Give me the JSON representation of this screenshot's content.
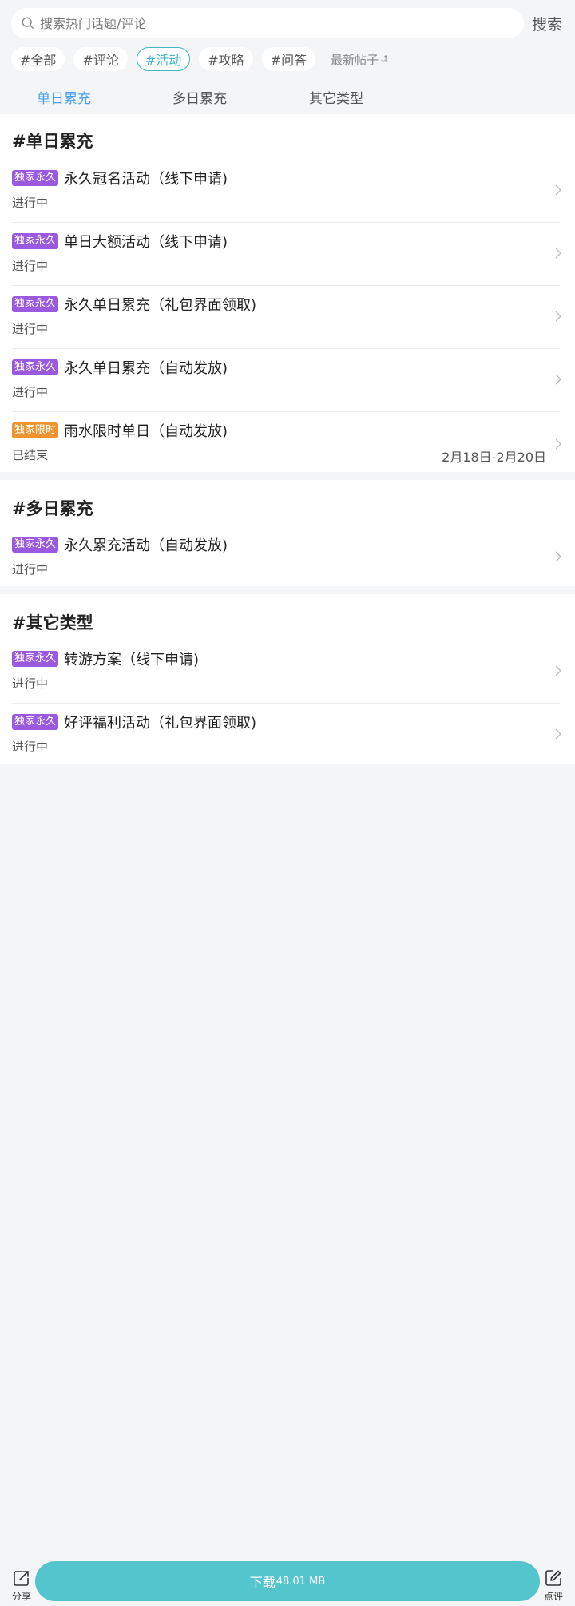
{
  "search": {
    "placeholder": "搜索热门话题/评论",
    "button_label": "搜索"
  },
  "tags": [
    {
      "label": "#全部"
    },
    {
      "label": "#评论"
    },
    {
      "label": "#活动"
    },
    {
      "label": "#攻略"
    },
    {
      "label": "#问答"
    }
  ],
  "sort": {
    "label": "最新帖子",
    "icon": "sort-arrows-icon"
  },
  "subtabs": [
    "单日累充",
    "多日累充",
    "其它类型"
  ],
  "sections": [
    {
      "title": "#单日累充",
      "items": [
        {
          "badge": "独家永久",
          "title": "永久冠名活动（线下申请)",
          "status": "进行中",
          "date": ""
        },
        {
          "badge": "独家永久",
          "title": "单日大额活动（线下申请)",
          "status": "进行中",
          "date": ""
        },
        {
          "badge": "独家永久",
          "title": "永久单日累充（礼包界面领取)",
          "status": "进行中",
          "date": ""
        },
        {
          "badge": "独家永久",
          "title": "永久单日累充（自动发放)",
          "status": "进行中",
          "date": ""
        },
        {
          "badge": "独家限时",
          "title": "雨水限时单日（自动发放)",
          "status": "已结束",
          "date": "2月18日-2月20日"
        }
      ]
    },
    {
      "title": "#多日累充",
      "items": [
        {
          "badge": "独家永久",
          "title": "永久累充活动（自动发放)",
          "status": "进行中",
          "date": ""
        }
      ]
    },
    {
      "title": "#其它类型",
      "items": [
        {
          "badge": "独家永久",
          "title": "转游方案（线下申请)",
          "status": "进行中",
          "date": ""
        },
        {
          "badge": "独家永久",
          "title": "好评福利活动（礼包界面领取)",
          "status": "进行中",
          "date": ""
        }
      ]
    }
  ],
  "bottom": {
    "share_label": "分享",
    "download_label": "下载",
    "download_size": "48.01 MB",
    "review_label": "点评"
  },
  "colors": {
    "accent": "#3db8c0",
    "tab_active": "#4a9ef0",
    "badge_permanent": "#9b59e0",
    "badge_limited": "#f0922e",
    "download_bg": "#55c5cd"
  }
}
